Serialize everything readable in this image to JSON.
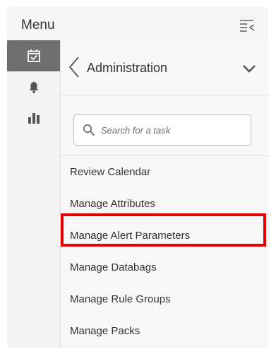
{
  "header": {
    "title": "Menu",
    "collapse_icon": "collapse-menu-icon"
  },
  "rail": {
    "items": [
      {
        "icon": "calendar-check-icon",
        "active": true
      },
      {
        "icon": "bell-icon",
        "active": false
      },
      {
        "icon": "bar-chart-icon",
        "active": false
      }
    ]
  },
  "panel": {
    "back_icon": "chevron-left-icon",
    "title": "Administration",
    "expand_icon": "chevron-down-icon"
  },
  "search": {
    "placeholder": "Search for a task",
    "value": "",
    "icon": "search-icon"
  },
  "tasks": [
    {
      "label": "Review Calendar"
    },
    {
      "label": "Manage Attributes"
    },
    {
      "label": "Manage Alert Parameters",
      "highlighted": true
    },
    {
      "label": "Manage Databags"
    },
    {
      "label": "Manage Rule Groups"
    },
    {
      "label": "Manage Packs"
    }
  ],
  "colors": {
    "highlight": "#e60000",
    "active_rail": "#6e6e6e",
    "text": "#333333"
  }
}
